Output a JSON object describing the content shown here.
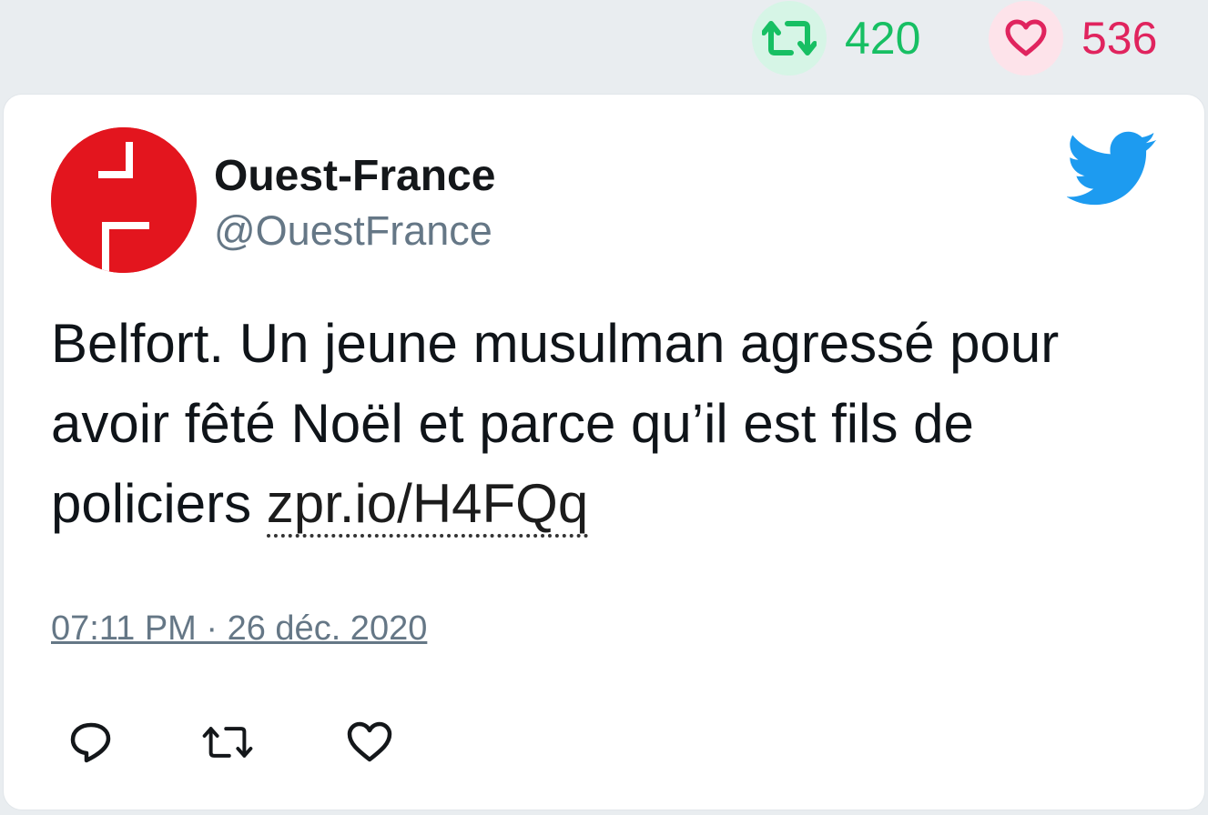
{
  "stats": {
    "retweet_count": "420",
    "like_count": "536"
  },
  "tweet": {
    "display_name": "Ouest-France",
    "handle": "@OuestFrance",
    "text": "Belfort. Un jeune musulman agressé pour avoir fêté Noël et parce qu’il est fils de policiers ",
    "link_text": "zpr.io/H4FQq",
    "timestamp": "07:11 PM · 26 déc. 2020"
  },
  "colors": {
    "retweet_green": "#17bf63",
    "like_pink": "#e0245e",
    "twitter_blue": "#1d9bf0",
    "avatar_red": "#e3151e"
  },
  "icons": {
    "retweet": "retweet-icon",
    "like": "heart-icon",
    "reply": "reply-icon",
    "brand": "twitter-bird-icon"
  }
}
